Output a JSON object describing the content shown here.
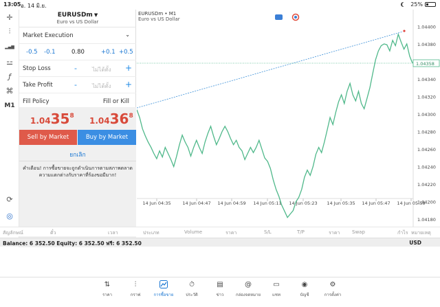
{
  "status_bar": {
    "time": "13:05",
    "date": "อ. 14 มิ.ย.",
    "battery": "25%"
  },
  "left_toolbar": {
    "items": [
      {
        "icon": "crosshair-icon",
        "glyph": "✛"
      },
      {
        "icon": "candlestick-icon",
        "glyph": "⫶"
      },
      {
        "icon": "bar-chart-icon",
        "glyph": "▂▄▆"
      },
      {
        "icon": "indicators-icon",
        "glyph": "⚍"
      },
      {
        "icon": "function-icon",
        "glyph": "ƒ"
      },
      {
        "icon": "shapes-icon",
        "glyph": "⌘"
      },
      {
        "label": "M1"
      },
      {
        "icon": "refresh-chart-icon",
        "glyph": "⟳"
      },
      {
        "icon": "logo-icon",
        "glyph": "◎"
      }
    ]
  },
  "order_panel": {
    "symbol": "EURUSDm",
    "symbol_desc": "Euro vs US Dollar",
    "execution": "Market Execution",
    "volume": {
      "minus_05": "-0.5",
      "minus_01": "-0.1",
      "value": "0.80",
      "plus_01": "+0.1",
      "plus_05": "+0.5"
    },
    "stop_loss": {
      "label": "Stop Loss",
      "minus": "-",
      "placeholder": "ไม่ได้ตั้ง",
      "plus": "+"
    },
    "take_profit": {
      "label": "Take Profit",
      "minus": "-",
      "placeholder": "ไม่ได้ตั้ง",
      "plus": "+"
    },
    "fill_policy": {
      "label": "Fill Policy",
      "value": "Fill or Kill"
    },
    "bid": {
      "small": "1.04",
      "big": "35",
      "sup": "8"
    },
    "ask": {
      "small": "1.04",
      "big": "36",
      "sup": "8"
    },
    "sell_label": "Sell by Market",
    "buy_label": "Buy by Market",
    "cancel_label": "ยกเลิก",
    "warning": "คำเตือน! การซื้อขายจะถูกดำเนินการตามสภาพตลาด ความแตกต่างกับราคาที่ร้องขอมีมาก!"
  },
  "chart_header": {
    "symbol": "EURUSDm • M1",
    "desc": "Euro vs US Dollar"
  },
  "chart_data": {
    "type": "line",
    "x_ticks": [
      "14 Jun 04:35",
      "14 Jun 04:47",
      "14 Jun 04:59",
      "14 Jun 05:11",
      "14 Jun 05:23",
      "14 Jun 05:35",
      "14 Jun 05:47",
      "14 Jun 05:59"
    ],
    "y_ticks": [
      "1.04400",
      "1.04380",
      "1.04360",
      "1.04340",
      "1.04320",
      "1.04300",
      "1.04280",
      "1.04260",
      "1.04240",
      "1.04220",
      "1.04200",
      "1.04180"
    ],
    "ylim": [
      1.0417,
      1.04405
    ],
    "current_price": "1.04358",
    "values": [
      1.04305,
      1.04296,
      1.04283,
      1.04275,
      1.04268,
      1.04262,
      1.04255,
      1.04249,
      1.04258,
      1.04251,
      1.04262,
      1.04255,
      1.04248,
      1.0424,
      1.04252,
      1.04265,
      1.04276,
      1.04268,
      1.04262,
      1.04252,
      1.04262,
      1.0427,
      1.04262,
      1.04255,
      1.04268,
      1.04278,
      1.04286,
      1.04275,
      1.04265,
      1.04272,
      1.0428,
      1.04286,
      1.0428,
      1.04272,
      1.04265,
      1.0427,
      1.04262,
      1.04258,
      1.04248,
      1.04255,
      1.04262,
      1.04256,
      1.04262,
      1.0427,
      1.0426,
      1.0425,
      1.04246,
      1.04238,
      1.04225,
      1.04214,
      1.04206,
      1.04196,
      1.04189,
      1.04182,
      1.04186,
      1.0419,
      1.042,
      1.04205,
      1.04214,
      1.04228,
      1.04236,
      1.0423,
      1.0424,
      1.04254,
      1.04262,
      1.04256,
      1.04268,
      1.04282,
      1.04296,
      1.04288,
      1.04302,
      1.04314,
      1.04322,
      1.04312,
      1.04326,
      1.04335,
      1.04322,
      1.04315,
      1.04326,
      1.04312,
      1.04306,
      1.04318,
      1.0433,
      1.04346,
      1.04362,
      1.04372,
      1.04378,
      1.0438,
      1.04379,
      1.04372,
      1.04384,
      1.04378,
      1.04391,
      1.04382,
      1.04374,
      1.0438,
      1.04366,
      1.04358
    ],
    "trendline": {
      "start": 1.04307,
      "end": 1.04394
    },
    "line_color": "#4fb88a",
    "trend_color": "#3a8fd8"
  },
  "positions_header": [
    "สัญลักษณ์",
    "ตั๋ว",
    "เวลา",
    "ประเภท",
    "Volume",
    "ราคา",
    "S/L",
    "T/P",
    "ราคา",
    "Swap",
    "กำไร",
    "หมายเหตุ"
  ],
  "balance_bar": {
    "text": "Balance: 6 352.50 Equity: 6 352.50 ฟรี: 6 352.50",
    "currency": "USD"
  },
  "bottom_nav": [
    {
      "label": "ราคา",
      "glyph": "⇅",
      "active": false
    },
    {
      "label": "กราฟ",
      "glyph": "⫶",
      "active": false
    },
    {
      "label": "การซื้อขาย",
      "glyph": "📈",
      "active": true
    },
    {
      "label": "ประวัติ",
      "glyph": "⏱",
      "active": false
    },
    {
      "label": "ข่าว",
      "glyph": "▤",
      "active": false
    },
    {
      "label": "กล่องจดหมาย",
      "glyph": "@",
      "active": false
    },
    {
      "label": "แชท",
      "glyph": "▭",
      "active": false
    },
    {
      "label": "บัญชี",
      "glyph": "◉",
      "active": false
    },
    {
      "label": "การตั้งค่า",
      "glyph": "⚙",
      "active": false
    }
  ]
}
